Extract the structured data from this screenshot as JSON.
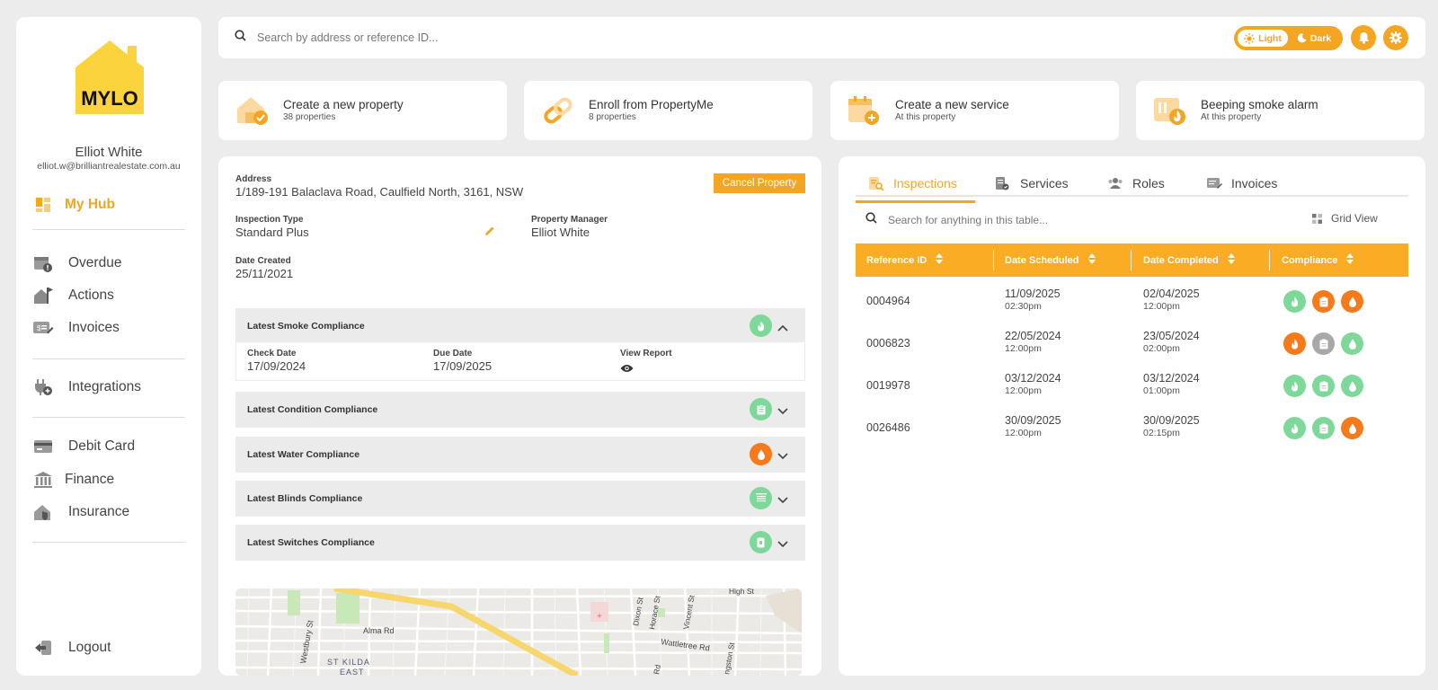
{
  "colors": {
    "accent": "#f4a622",
    "compliant": "#7dd89a",
    "noncompliant": "#f47a1c",
    "neutral": "#a8a8a8"
  },
  "sidebar": {
    "logo_text": "MYLO",
    "user_name": "Elliot White",
    "user_email": "elliot.w@brilliantrealestate.com.au",
    "items": [
      {
        "label": "My Hub",
        "icon": "dashboard-icon"
      },
      {
        "label": "Overdue",
        "icon": "calendar-alert-icon"
      },
      {
        "label": "Actions",
        "icon": "house-flag-icon"
      },
      {
        "label": "Invoices",
        "icon": "invoice-icon"
      },
      {
        "label": "Integrations",
        "icon": "plug-icon"
      },
      {
        "label": "Debit Card",
        "icon": "card-icon"
      },
      {
        "label": "Finance",
        "icon": "bank-icon"
      },
      {
        "label": "Insurance",
        "icon": "house-shield-icon"
      }
    ],
    "logout_label": "Logout"
  },
  "topbar": {
    "search_placeholder": "Search by address or reference ID...",
    "theme_light": "Light",
    "theme_dark": "Dark"
  },
  "quick_actions": [
    {
      "title": "Create a new property",
      "subtitle": "38 properties",
      "icon": "house-check-icon"
    },
    {
      "title": "Enroll from PropertyMe",
      "subtitle": "8 properties",
      "icon": "link-icon"
    },
    {
      "title": "Create a new service",
      "subtitle": "At this property",
      "icon": "calendar-plus-icon"
    },
    {
      "title": "Beeping smoke alarm",
      "subtitle": "At this property",
      "icon": "smoke-alarm-icon"
    }
  ],
  "property": {
    "address_label": "Address",
    "address": "1/189-191 Balaclava Road, Caulfield North, 3161, NSW",
    "cancel_label": "Cancel Property",
    "inspection_type_label": "Inspection Type",
    "inspection_type": "Standard Plus",
    "manager_label": "Property Manager",
    "manager": "Elliot White",
    "date_created_label": "Date Created",
    "date_created": "25/11/2021",
    "compliance": [
      {
        "title": "Latest Smoke Compliance",
        "status": "compliant",
        "icon": "flame-icon",
        "expanded": true
      },
      {
        "title": "Latest Condition Compliance",
        "status": "compliant",
        "icon": "clipboard-icon",
        "expanded": false
      },
      {
        "title": "Latest Water Compliance",
        "status": "noncompliant",
        "icon": "water-drop-icon",
        "expanded": false
      },
      {
        "title": "Latest Blinds Compliance",
        "status": "compliant",
        "icon": "blinds-icon",
        "expanded": false
      },
      {
        "title": "Latest Switches Compliance",
        "status": "compliant",
        "icon": "switch-icon",
        "expanded": false
      }
    ],
    "smoke_detail": {
      "check_date_label": "Check Date",
      "check_date": "17/09/2024",
      "due_date_label": "Due Date",
      "due_date": "17/09/2025",
      "view_report_label": "View Report"
    },
    "map_labels": [
      "Alma Rd",
      "Westbury St",
      "ST KILDA",
      "EAST",
      "Dixon St",
      "Horace St",
      "Vincent St",
      "Wattletree Rd",
      "High St",
      "ngston St",
      "Rd"
    ]
  },
  "inspections": {
    "tabs": [
      {
        "label": "Inspections",
        "icon": "inspection-icon"
      },
      {
        "label": "Services",
        "icon": "service-icon"
      },
      {
        "label": "Roles",
        "icon": "people-icon"
      },
      {
        "label": "Invoices",
        "icon": "invoice-icon"
      }
    ],
    "search_placeholder": "Search for anything in this table...",
    "grid_view_label": "Grid View",
    "columns": [
      "Reference ID",
      "Date Scheduled",
      "Date Completed",
      "Compliance"
    ],
    "rows": [
      {
        "ref": "0004964",
        "scheduled_date": "11/09/2025",
        "scheduled_time": "02:30pm",
        "completed_date": "02/04/2025",
        "completed_time": "12:00pm",
        "compliance": [
          "compliant",
          "noncompliant",
          "noncompliant"
        ]
      },
      {
        "ref": "0006823",
        "scheduled_date": "22/05/2024",
        "scheduled_time": "12:00pm",
        "completed_date": "23/05/2024",
        "completed_time": "02:00pm",
        "compliance": [
          "noncompliant",
          "neutral",
          "compliant"
        ]
      },
      {
        "ref": "0019978",
        "scheduled_date": "03/12/2024",
        "scheduled_time": "12:00pm",
        "completed_date": "03/12/2024",
        "completed_time": "01:00pm",
        "compliance": [
          "compliant",
          "compliant",
          "compliant"
        ]
      },
      {
        "ref": "0026486",
        "scheduled_date": "30/09/2025",
        "scheduled_time": "12:00pm",
        "completed_date": "30/09/2025",
        "completed_time": "02:15pm",
        "compliance": [
          "compliant",
          "compliant",
          "noncompliant"
        ]
      }
    ]
  }
}
